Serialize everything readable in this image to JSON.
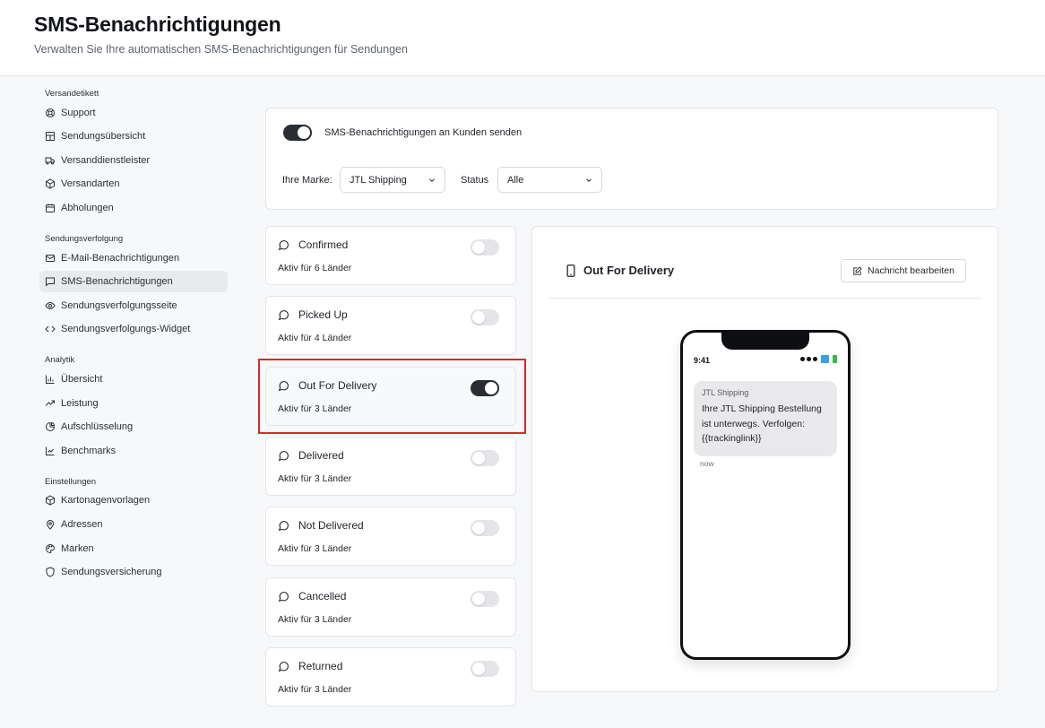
{
  "header": {
    "title": "SMS-Benachrichtigungen",
    "subtitle": "Verwalten Sie Ihre automatischen SMS-Benachrichtigungen für Sendungen"
  },
  "sidebar": {
    "sections": [
      {
        "label": "Versandetikett",
        "items": [
          {
            "label": "Support",
            "icon": "lifebuoy-icon"
          },
          {
            "label": "Sendungsübersicht",
            "icon": "layout-grid-icon"
          },
          {
            "label": "Versanddienstleister",
            "icon": "truck-icon"
          },
          {
            "label": "Versandarten",
            "icon": "package-icon"
          },
          {
            "label": "Abholungen",
            "icon": "calendar-icon"
          }
        ]
      },
      {
        "label": "Sendungsverfolgung",
        "items": [
          {
            "label": "E-Mail-Benachrichtigungen",
            "icon": "mail-icon"
          },
          {
            "label": "SMS-Benachrichtigungen",
            "icon": "message-square-icon",
            "active": true
          },
          {
            "label": "Sendungsverfolgungsseite",
            "icon": "eye-icon"
          },
          {
            "label": "Sendungsverfolgungs-Widget",
            "icon": "code-icon"
          }
        ]
      },
      {
        "label": "Analytik",
        "items": [
          {
            "label": "Übersicht",
            "icon": "bar-chart-icon"
          },
          {
            "label": "Leistung",
            "icon": "trending-up-icon"
          },
          {
            "label": "Aufschlüsselung",
            "icon": "pie-chart-icon"
          },
          {
            "label": "Benchmarks",
            "icon": "line-chart-icon"
          }
        ]
      },
      {
        "label": "Einstellungen",
        "items": [
          {
            "label": "Kartonagenvorlagen",
            "icon": "box-icon"
          },
          {
            "label": "Adressen",
            "icon": "map-pin-icon"
          },
          {
            "label": "Marken",
            "icon": "palette-icon"
          },
          {
            "label": "Sendungsversicherung",
            "icon": "shield-icon"
          }
        ]
      }
    ]
  },
  "settings": {
    "toggle_label": "SMS-Benachrichtigungen an Kunden senden",
    "toggle_on": true,
    "brand_label": "Ihre Marke:",
    "brand_value": "JTL Shipping",
    "status_label": "Status",
    "status_value": "Alle"
  },
  "events": [
    {
      "title": "Confirmed",
      "subtitle": "Aktiv für 6 Länder",
      "enabled": false
    },
    {
      "title": "Picked Up",
      "subtitle": "Aktiv für 4 Länder",
      "enabled": false
    },
    {
      "title": "Out For Delivery",
      "subtitle": "Aktiv für 3 Länder",
      "enabled": true,
      "selected": true
    },
    {
      "title": "Delivered",
      "subtitle": "Aktiv für 3 Länder",
      "enabled": false
    },
    {
      "title": "Not Delivered",
      "subtitle": "Aktiv für 3 Länder",
      "enabled": false
    },
    {
      "title": "Cancelled",
      "subtitle": "Aktiv für 3 Länder",
      "enabled": false
    },
    {
      "title": "Returned",
      "subtitle": "Aktiv für 3 Länder",
      "enabled": false
    }
  ],
  "preview": {
    "title": "Out For Delivery",
    "edit_label": "Nachricht bearbeiten",
    "phone_time": "9:41",
    "sender": "JTL Shipping",
    "message": "Ihre JTL Shipping Bestellung ist unterwegs. Verfolgen: {{trackinglink}}",
    "message_time": "now"
  },
  "colors": {
    "toggle_on": "#2a2e34",
    "toggle_off": "#e4e5e8",
    "highlight": "#d72a2a",
    "active_nav": "#e9eaec"
  }
}
